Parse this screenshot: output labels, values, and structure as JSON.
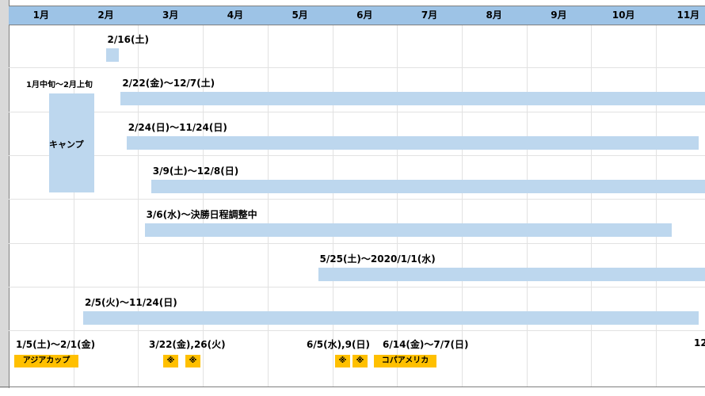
{
  "chart_data": {
    "type": "gantt",
    "months": [
      "1月",
      "2月",
      "3月",
      "4月",
      "5月",
      "6月",
      "7月",
      "8月",
      "9月",
      "10月",
      "11月"
    ],
    "rows": [
      {
        "label": "2/16(土)",
        "start_month": 2.5,
        "end_month": 2.7
      },
      {
        "label": "2/22(金)～12/7(土)",
        "start_month": 2.73,
        "end_month": 12.0
      },
      {
        "label": "2/24(日)～11/24(日)",
        "start_month": 2.82,
        "end_month": 11.66
      },
      {
        "label": "3/9(土)～12/8(日)",
        "start_month": 3.2,
        "end_month": 12.0
      },
      {
        "label": "3/6(水)～決勝日程調整中",
        "start_month": 3.1,
        "end_month": 11.25
      },
      {
        "label": "5/25(土)～2020/1/1(水)",
        "start_month": 5.78,
        "end_month": 12.0
      },
      {
        "label": "2/5(火)～11/24(日)",
        "start_month": 2.15,
        "end_month": 11.66
      }
    ],
    "camp": {
      "label": "1月中旬～2月上旬",
      "text": "キャンプ",
      "start_month": 1.62,
      "end_month": 2.32
    }
  },
  "events": {
    "asia_dates": "1/5(土)～2/1(金)",
    "asia_tag": "アジアカップ",
    "march_dates": "3/22(金),26(火)",
    "june_dates": "6/5(水),9(日)",
    "copa_dates": "6/14(金)～7/7(日)",
    "copa_tag": "コパアメリカ",
    "mark": "※",
    "clipped_right": "12"
  }
}
